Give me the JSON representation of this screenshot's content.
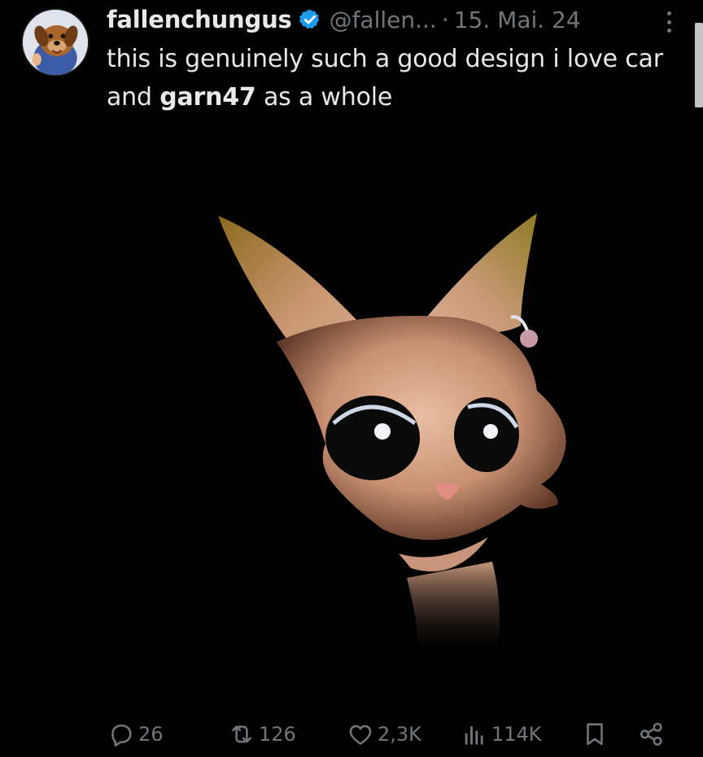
{
  "tweet": {
    "display_name": "fallenchungus",
    "handle": "@fallen...",
    "separator": "·",
    "date": "15. Mai. 24",
    "text_part1": "this is genuinely such a good design  i love car and ",
    "text_mention": "garn47",
    "text_part2": " as a whole"
  },
  "icons": {
    "avatar": "dog-avatar",
    "verified": "verified-badge-icon",
    "more": "more-icon",
    "reply": "reply-icon",
    "retweet": "retweet-icon",
    "like": "like-icon",
    "views": "views-icon",
    "bookmark": "bookmark-icon",
    "share": "share-icon"
  },
  "actions": {
    "replies": "26",
    "retweets": "126",
    "likes": "2,3K",
    "views": "114K"
  },
  "colors": {
    "background": "#000000",
    "text": "#e7e9ea",
    "muted": "#71767b",
    "verified": "#1d9bf0"
  }
}
